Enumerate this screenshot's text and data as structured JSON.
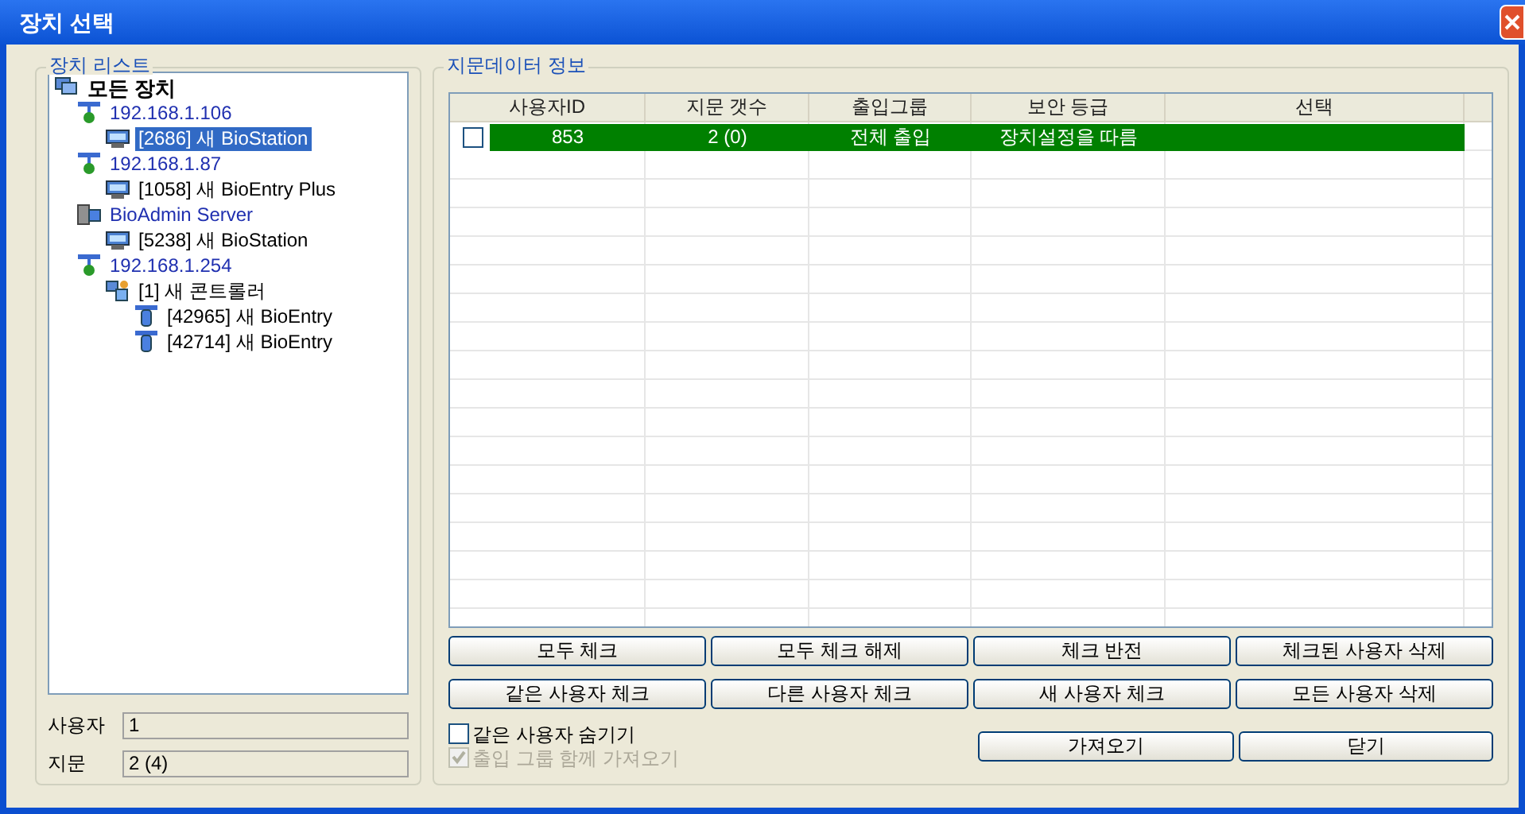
{
  "window": {
    "title": "장치 선택"
  },
  "device_list": {
    "title": "장치 리스트",
    "tree": [
      {
        "label": "모든 장치",
        "kind": "root",
        "selected": false,
        "children": [
          {
            "label": "192.168.1.106",
            "kind": "network",
            "selected": false,
            "children": [
              {
                "label": "[2686] 새 BioStation",
                "kind": "station",
                "selected": true
              }
            ]
          },
          {
            "label": "192.168.1.87",
            "kind": "network",
            "selected": false,
            "children": [
              {
                "label": "[1058] 새 BioEntry Plus",
                "kind": "station",
                "selected": false
              }
            ]
          },
          {
            "label": "BioAdmin Server",
            "kind": "server",
            "selected": false,
            "children": [
              {
                "label": "[5238] 새 BioStation",
                "kind": "station",
                "selected": false
              }
            ]
          },
          {
            "label": "192.168.1.254",
            "kind": "network",
            "selected": false,
            "children": [
              {
                "label": "[1] 새 콘트롤러",
                "kind": "controller",
                "selected": false,
                "children": [
                  {
                    "label": "[42965] 새 BioEntry",
                    "kind": "entry",
                    "selected": false
                  },
                  {
                    "label": "[42714] 새 BioEntry",
                    "kind": "entry",
                    "selected": false
                  }
                ]
              }
            ]
          }
        ]
      }
    ],
    "fields": [
      {
        "label": "사용자",
        "value": "1"
      },
      {
        "label": "지문",
        "value": "2 (4)"
      }
    ]
  },
  "fingerprint_data": {
    "title": "지문데이터 정보",
    "table": {
      "columns": [
        "사용자ID",
        "지문 갯수",
        "출입그룹",
        "보안 등급",
        "선택"
      ],
      "rows": [
        {
          "checked": false,
          "selected": true,
          "cells": [
            "853",
            "2 (0)",
            "전체 출입",
            "장치설정을 따름",
            ""
          ]
        }
      ]
    },
    "buttons": [
      [
        "모두 체크",
        "모두 체크 해제",
        "체크 반전",
        "체크된 사용자 삭제"
      ],
      [
        "같은 사용자 체크",
        "다른 사용자 체크",
        "새 사용자 체크",
        "모든 사용자 삭제"
      ]
    ],
    "options": [
      {
        "label": "같은 사용자 숨기기",
        "checked": false,
        "disabled": false
      },
      {
        "label": "출입 그룹 함께 가져오기",
        "checked": true,
        "disabled": true
      }
    ],
    "footer_buttons": [
      "가져오기",
      "닫기"
    ]
  }
}
